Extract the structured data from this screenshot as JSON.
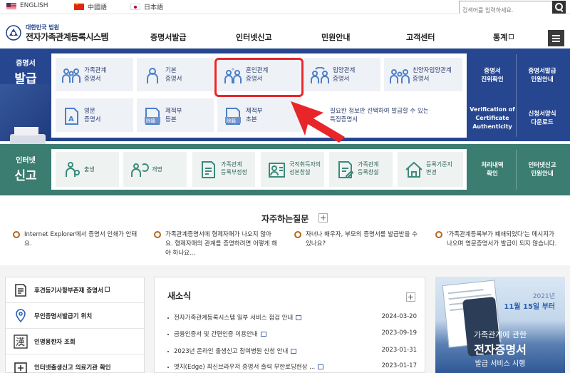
{
  "languages": [
    {
      "label": "ENGLISH",
      "flag": "us-flag-icon"
    },
    {
      "label": "中國語",
      "flag": "cn-flag-icon"
    },
    {
      "label": "日本語",
      "flag": "jp-flag-icon"
    }
  ],
  "search": {
    "placeholder": "검색어를 입력하세요."
  },
  "logo": {
    "sub": "대한민국 법원",
    "main": "전자가족관계등록시스템"
  },
  "gnb": [
    "증명서발급",
    "인터넷신고",
    "민원안내",
    "고객센터",
    "통계"
  ],
  "issue": {
    "title_small": "증명서",
    "title_big": "발급",
    "tiles": [
      {
        "l1": "가족관계",
        "l2": "증명서",
        "icon": "family-icon"
      },
      {
        "l1": "기본",
        "l2": "증명서",
        "icon": "person-icon"
      },
      {
        "l1": "혼인관계",
        "l2": "증명서",
        "icon": "couple-icon"
      },
      {
        "l1": "입양관계",
        "l2": "증명서",
        "icon": "adoption-icon"
      },
      {
        "l1": "친양자입양관계",
        "l2": "증명서",
        "icon": "family-icon"
      },
      {
        "l1": "영문",
        "l2": "증명서",
        "icon": "english-doc-icon"
      },
      {
        "l1": "제적부",
        "l2": "등본",
        "icon": "removed-register-icon"
      },
      {
        "l1": "제적부",
        "l2": "초본",
        "icon": "removed-register-icon"
      }
    ],
    "badge_text": "除籍",
    "hint": {
      "l1": "필요한 정보만 선택하여 발급할 수 있는",
      "l2": "특정증명서"
    },
    "side": [
      {
        "l1": "증명서",
        "l2": "진위확인"
      },
      {
        "l1": "증명서발급",
        "l2": "민원안내"
      },
      {
        "l1": "Verification of",
        "l2": "Certificate",
        "l3": "Authenticity"
      },
      {
        "l1": "신청서양식",
        "l2": "다운로드"
      }
    ]
  },
  "report": {
    "title_small": "인터넷",
    "title_big": "신고",
    "tiles": [
      {
        "l1": "출생",
        "icon": "birth-icon"
      },
      {
        "l1": "개명",
        "icon": "rename-icon"
      },
      {
        "l1": "가족관계",
        "l2": "등록부정정",
        "icon": "register-correction-icon"
      },
      {
        "l1": "국적취득자의",
        "l2": "성본창설",
        "icon": "nationality-icon"
      },
      {
        "l1": "가족관계",
        "l2": "등록창설",
        "icon": "register-create-icon"
      },
      {
        "l1": "등록기준지",
        "l2": "변경",
        "icon": "house-icon"
      }
    ],
    "side": [
      {
        "l1": "처리내역",
        "l2": "확인"
      },
      {
        "l1": "인터넷신고",
        "l2": "민원안내"
      }
    ]
  },
  "faq": {
    "title": "자주하는질문",
    "items": [
      {
        "l1": "Internet Explorer에서 증명서 인쇄가 안돼",
        "l2": "요."
      },
      {
        "l1": "가족관계증명서에 형제자매가 나오지 않아",
        "l2": "요. 형제자매의 관계를 증명하려면 어떻게 해",
        "l3": "야 하나요..."
      },
      {
        "l1": "자녀나 배우자, 부모의 증명서를 발급받을 수",
        "l2": "있나요?"
      },
      {
        "l1": "'가족관계등록부가 폐쇄되었다'는 메시지가",
        "l2": "나오며 영문증명서가 발급이 되지 않습니다."
      }
    ]
  },
  "quick": [
    {
      "label": "후견등기사항부존재 증명서",
      "icon": "document-icon"
    },
    {
      "label": "무인증명서발급기 위치",
      "icon": "location-icon"
    },
    {
      "label": "인명용한자 조회",
      "icon": "hanja-icon"
    },
    {
      "label": "인터넷출생신고 의료기관 확인",
      "icon": "hospital-icon"
    }
  ],
  "hanja_char": "漢",
  "news": {
    "title": "새소식",
    "items": [
      {
        "text": "전자가족관계등록시스템 일부 서비스 점검 안내",
        "date": "2024-03-20"
      },
      {
        "text": "금융인증서 및 간편인증 이용안내",
        "date": "2023-09-19"
      },
      {
        "text": "2023년 온라인 출생신고 참여병원 신청 안내",
        "date": "2023-01-31"
      },
      {
        "text": "엣지(Edge) 최신브라우저 증명서 출력 무한로딩현상 ...",
        "date": "2023-01-17"
      }
    ]
  },
  "banner": {
    "year": "2021년",
    "date": "11월 15일 부터",
    "l1": "가족관계에 관한",
    "l2": "전자증명서",
    "l3": "발급 서비스 시행"
  },
  "colors": {
    "issue_band": "#26468f",
    "report_band": "#3b7d71",
    "highlight": "#e8262a"
  }
}
